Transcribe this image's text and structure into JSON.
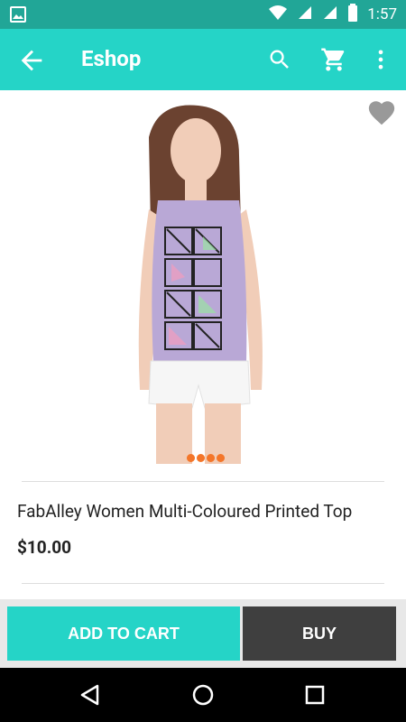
{
  "status_bar": {
    "time": "1:57",
    "icons": [
      "image-notification-icon",
      "wifi-icon",
      "signal-icon",
      "signal-icon-2",
      "battery-icon"
    ]
  },
  "app_bar": {
    "title": "Eshop",
    "icons": [
      "back-arrow-icon",
      "search-icon",
      "cart-icon",
      "more-vert-icon"
    ]
  },
  "product": {
    "title": "FabAlley Women Multi-Coloured Printed Top",
    "price": "$10.00",
    "image_alt_icon": "product-photo",
    "favorite_icon": "heart-icon",
    "carousel_dots": 4,
    "carousel_active_index": 0
  },
  "actions": {
    "add_to_cart_label": "ADD TO CART",
    "buy_label": "BUY"
  },
  "navigation": {
    "icons": [
      "nav-back-icon",
      "nav-home-icon",
      "nav-recents-icon"
    ]
  },
  "colors": {
    "status_bar": "#21a697",
    "primary": "#25d4c7",
    "buy_button": "#3f3f3f",
    "dot_accent": "#f4762a",
    "favorite_icon": "#999999",
    "nav_bar": "#000000"
  }
}
